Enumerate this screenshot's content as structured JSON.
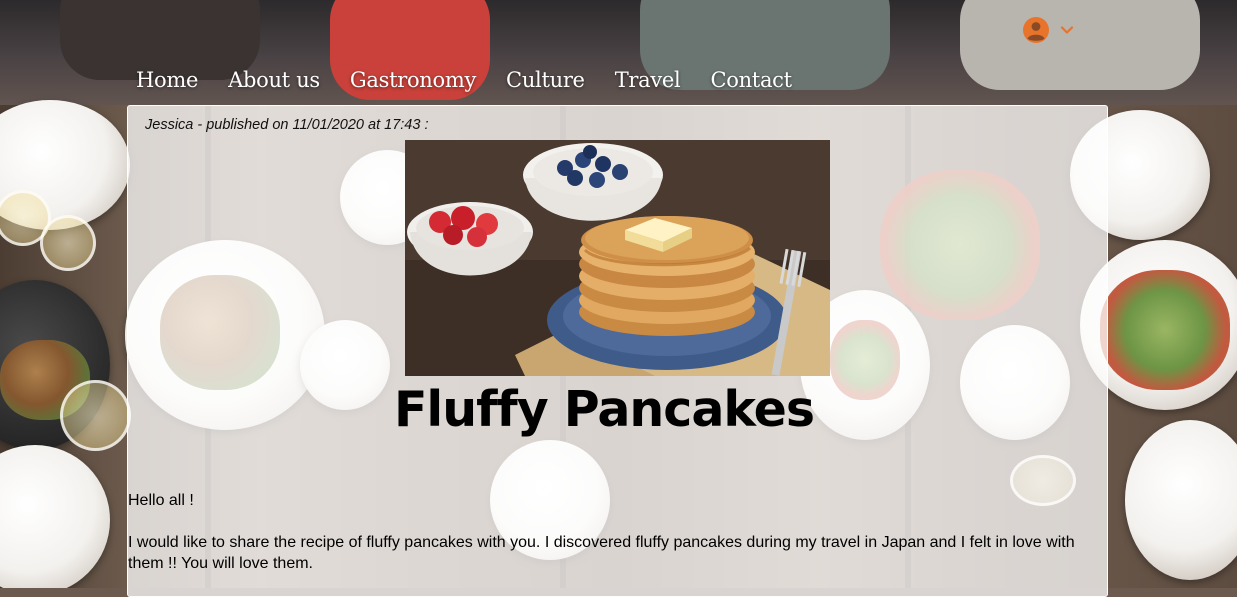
{
  "nav": {
    "items": [
      {
        "label": "Home"
      },
      {
        "label": "About us"
      },
      {
        "label": "Gastronomy"
      },
      {
        "label": "Culture"
      },
      {
        "label": "Travel"
      },
      {
        "label": "Contact"
      }
    ]
  },
  "account": {
    "avatar_icon": "account-circle-icon",
    "chevron_icon": "chevron-down-icon",
    "accent_color": "#e8732a"
  },
  "post": {
    "meta": "Jessica - published on 11/01/2020 at 17:43 :",
    "title": "Fluffy Pancakes",
    "image_icon": "pancake-stack-photo",
    "paragraphs": [
      "Hello all !",
      "I would like to share the recipe of fluffy pancakes with you. I discovered fluffy pancakes during my travel in Japan and I felt in love with them !! You will love them."
    ]
  }
}
